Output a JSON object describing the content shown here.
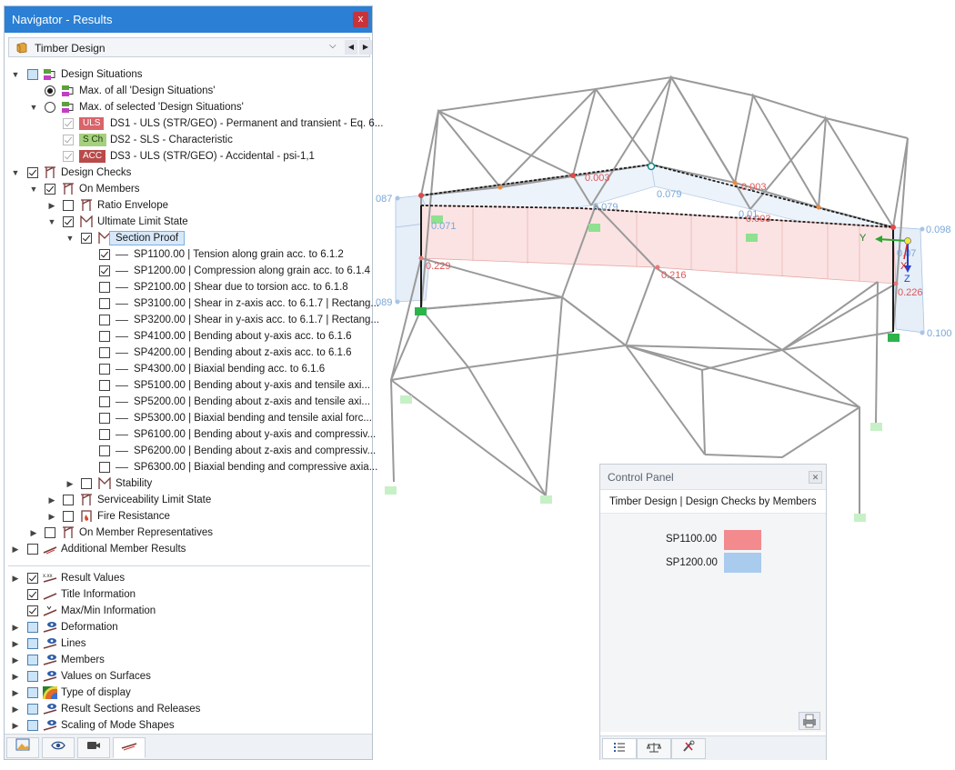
{
  "navigator": {
    "title": "Navigator - Results",
    "close_glyph": "x",
    "combo": {
      "label": "Timber Design",
      "arrow": "⌵",
      "prev": "◀",
      "next": "▶"
    },
    "tree": {
      "design_situations": "Design Situations",
      "max_all": "Max. of all 'Design Situations'",
      "max_selected": "Max. of selected 'Design Situations'",
      "ds": [
        {
          "badge": "ULS",
          "label": "DS1 - ULS (STR/GEO) - Permanent and transient - Eq. 6..."
        },
        {
          "badge": "S Ch",
          "label": "DS2 - SLS - Characteristic"
        },
        {
          "badge": "ACC",
          "label": "DS3 - ULS (STR/GEO) - Accidental - psi-1,1"
        }
      ],
      "design_checks": "Design Checks",
      "on_members": "On Members",
      "ratio_envelope": "Ratio Envelope",
      "uls": "Ultimate Limit State",
      "section_proof": "Section Proof",
      "checks": [
        "SP1100.00 | Tension along grain acc. to 6.1.2",
        "SP1200.00 | Compression along grain acc. to 6.1.4",
        "SP2100.00 | Shear due to torsion acc. to 6.1.8",
        "SP3100.00 | Shear in z-axis acc. to 6.1.7 | Rectang...",
        "SP3200.00 | Shear in y-axis acc. to 6.1.7 | Rectang...",
        "SP4100.00 | Bending about y-axis acc. to 6.1.6",
        "SP4200.00 | Bending about z-axis acc. to 6.1.6",
        "SP4300.00 | Biaxial bending acc. to 6.1.6",
        "SP5100.00 | Bending about y-axis and tensile axi...",
        "SP5200.00 | Bending about z-axis and tensile axi...",
        "SP5300.00 | Biaxial bending and tensile axial forc...",
        "SP6100.00 | Bending about y-axis and compressiv...",
        "SP6200.00 | Bending about z-axis and compressiv...",
        "SP6300.00 | Biaxial bending and compressive axia..."
      ],
      "stability": "Stability",
      "sls": "Serviceability Limit State",
      "fire": "Fire Resistance",
      "member_reps": "On Member Representatives",
      "additional": "Additional Member Results",
      "display_items": [
        "Result Values",
        "Title Information",
        "Max/Min Information",
        "Deformation",
        "Lines",
        "Members",
        "Values on Surfaces",
        "Type of display",
        "Result Sections and Releases",
        "Scaling of Mode Shapes"
      ]
    },
    "tab_icons": [
      "image-icon",
      "eye-icon",
      "camera-icon",
      "results-icon"
    ]
  },
  "viewport": {
    "values_red": [
      "0.003",
      "0.003",
      "0.229",
      "0.216",
      "0.226"
    ],
    "values_blue": [
      ".087",
      "0.079",
      "0.079",
      "0.071",
      "0.098",
      ".089",
      "0.100",
      "0.01",
      "0.003",
      "0.07"
    ],
    "axes": {
      "x": "X",
      "y": "Y",
      "z": "Z"
    }
  },
  "control_panel": {
    "title": "Control Panel",
    "subtitle": "Timber Design | Design Checks by Members",
    "legend": [
      {
        "label": "SP1100.00",
        "color": "#f28a8e"
      },
      {
        "label": "SP1200.00",
        "color": "#a9cbee"
      }
    ],
    "tab_icons": [
      "list-icon",
      "balance-icon",
      "tools-icon"
    ]
  }
}
